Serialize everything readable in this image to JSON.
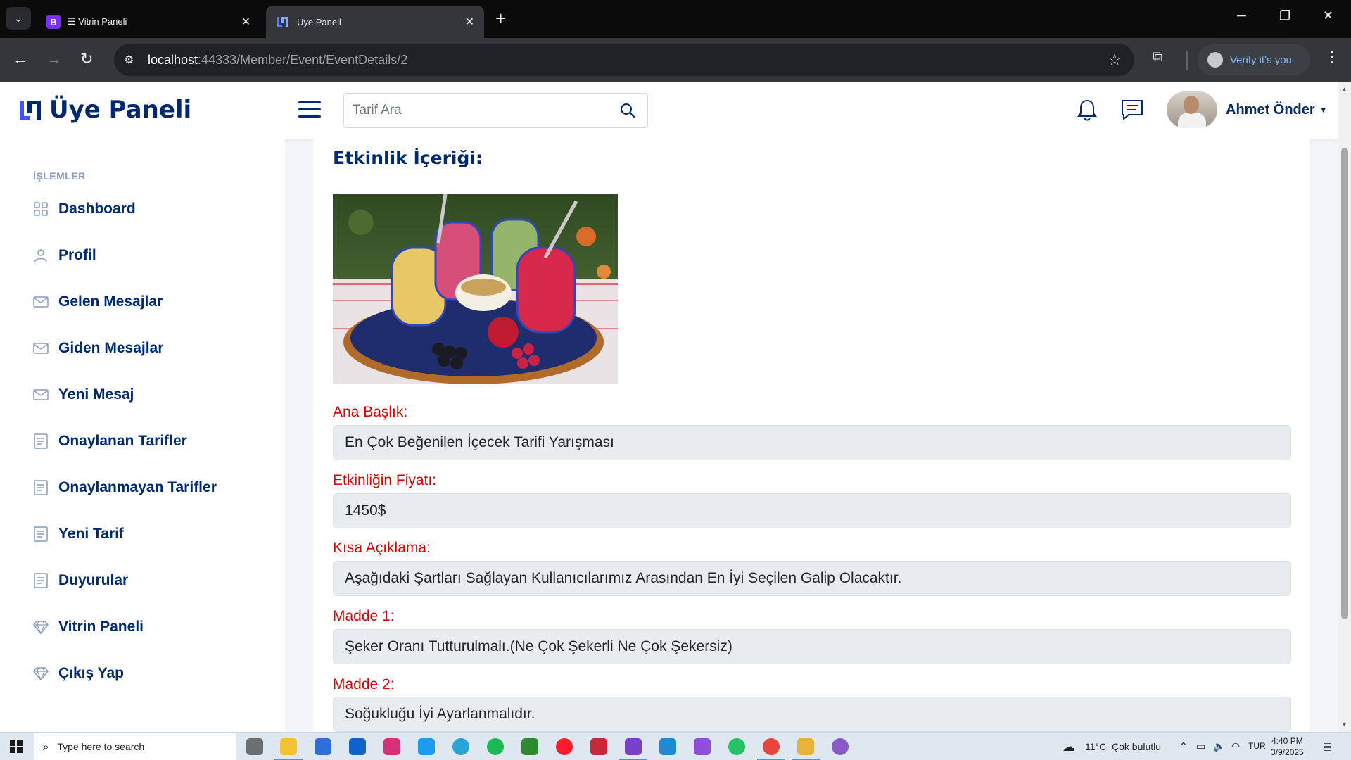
{
  "browser": {
    "tabs": [
      {
        "title": "☰ Vitrin Paneli",
        "favicon": "B",
        "active": false
      },
      {
        "title": "Üye Paneli",
        "active": true
      }
    ],
    "url_host": "localhost",
    "url_path": ":44333/Member/Event/EventDetails/2",
    "verify_label": "Verify it's you"
  },
  "header": {
    "brand_name": "Üye Paneli",
    "search_placeholder": "Tarif Ara",
    "user_name": "Ahmet Önder"
  },
  "sidebar": {
    "section_title": "İŞLEMLER",
    "items": [
      {
        "label": "Dashboard",
        "icon": "grid-icon"
      },
      {
        "label": "Profil",
        "icon": "person-icon"
      },
      {
        "label": "Gelen Mesajlar",
        "icon": "envelope-icon"
      },
      {
        "label": "Giden Mesajlar",
        "icon": "envelope-icon"
      },
      {
        "label": "Yeni Mesaj",
        "icon": "envelope-icon"
      },
      {
        "label": "Onaylanan Tarifler",
        "icon": "document-icon"
      },
      {
        "label": "Onaylanmayan Tarifler",
        "icon": "document-icon"
      },
      {
        "label": "Yeni Tarif",
        "icon": "document-icon"
      },
      {
        "label": "Duyurular",
        "icon": "document-icon"
      },
      {
        "label": "Vitrin Paneli",
        "icon": "gem-icon"
      },
      {
        "label": "Çıkış Yap",
        "icon": "gem-icon"
      }
    ]
  },
  "content": {
    "title": "Etkinlik İçeriği:",
    "fields": [
      {
        "label": "Ana Başlık:",
        "value": "En Çok Beğenilen İçecek Tarifi Yarışması"
      },
      {
        "label": "Etkinliğin Fiyatı:",
        "value": "1450$"
      },
      {
        "label": "Kısa Açıklama:",
        "value": "Aşağıdaki Şartları Sağlayan Kullanıcılarımız Arasından En İyi Seçilen Galip Olacaktır."
      },
      {
        "label": "Madde 1:",
        "value": "Şeker Oranı Tutturulmalı.(Ne Çok Şekerli Ne Çok Şekersiz)"
      },
      {
        "label": "Madde 2:",
        "value": "Soğukluğu İyi Ayarlanmalıdır."
      }
    ]
  },
  "taskbar": {
    "search_placeholder": "Type here to search",
    "weather_temp": "11°C",
    "weather_desc": "Çok bulutlu",
    "language": "TUR",
    "time": "4:40 PM",
    "date": "3/9/2025"
  },
  "colors": {
    "brand": "#012970",
    "label_red": "#e00000",
    "field_bg": "#e9ecef"
  }
}
